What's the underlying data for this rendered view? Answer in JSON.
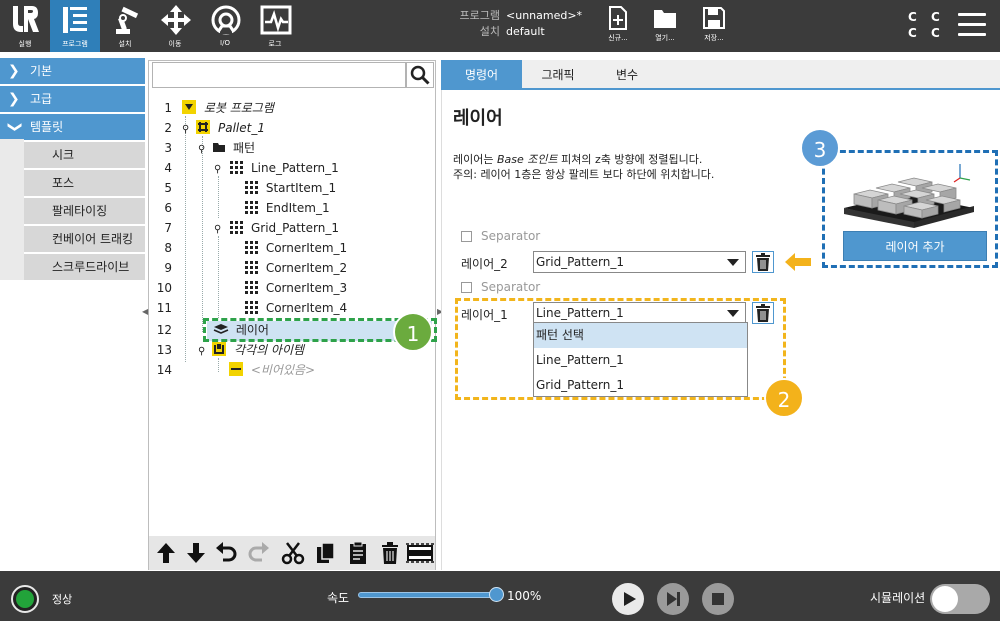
{
  "topbar": {
    "nav": [
      {
        "label": "실행",
        "icon": "ur-logo-icon"
      },
      {
        "label": "프로그램",
        "icon": "program-icon"
      },
      {
        "label": "설치",
        "icon": "robot-arm-icon"
      },
      {
        "label": "이동",
        "icon": "move-arrows-icon"
      },
      {
        "label": "I/O",
        "icon": "io-icon"
      },
      {
        "label": "로그",
        "icon": "log-icon"
      }
    ],
    "program_label": "프로그램",
    "program_value": "<unnamed>*",
    "install_label": "설치",
    "install_value": "default",
    "file_buttons": [
      {
        "label": "신규...",
        "icon": "new-file-icon"
      },
      {
        "label": "열기...",
        "icon": "open-folder-icon"
      },
      {
        "label": "저장...",
        "icon": "save-icon"
      }
    ],
    "cc_text": [
      "C C",
      "C C"
    ]
  },
  "sidebar": {
    "categories": [
      {
        "label": "기본",
        "expanded": false
      },
      {
        "label": "고급",
        "expanded": false
      },
      {
        "label": "템플릿",
        "expanded": true
      }
    ],
    "template_items": [
      "시크",
      "포스",
      "팔레타이징",
      "컨베이어 트래킹",
      "스크루드라이브"
    ]
  },
  "tree": {
    "rows": [
      {
        "num": "1",
        "label": "로봇 프로그램",
        "icon": "program-root-icon"
      },
      {
        "num": "2",
        "label": "Pallet_1",
        "icon": "pallet-icon"
      },
      {
        "num": "3",
        "label": "패턴",
        "icon": "folder-icon"
      },
      {
        "num": "4",
        "label": "Line_Pattern_1",
        "icon": "line-pattern-icon"
      },
      {
        "num": "5",
        "label": "StartItem_1",
        "icon": "grid-item-icon"
      },
      {
        "num": "6",
        "label": "EndItem_1",
        "icon": "grid-item-icon"
      },
      {
        "num": "7",
        "label": "Grid_Pattern_1",
        "icon": "grid-pattern-icon"
      },
      {
        "num": "8",
        "label": "CornerItem_1",
        "icon": "grid-item-icon"
      },
      {
        "num": "9",
        "label": "CornerItem_2",
        "icon": "grid-item-icon"
      },
      {
        "num": "10",
        "label": "CornerItem_3",
        "icon": "grid-item-icon"
      },
      {
        "num": "11",
        "label": "CornerItem_4",
        "icon": "grid-item-icon"
      },
      {
        "num": "12",
        "label": "레이어",
        "icon": "layer-icon"
      },
      {
        "num": "13",
        "label": "각각의 아이템",
        "icon": "each-item-icon"
      },
      {
        "num": "14",
        "label": "<비어있음>",
        "icon": "empty-icon"
      }
    ],
    "toolbar": [
      "move-up-icon",
      "move-down-icon",
      "undo-icon",
      "redo-icon",
      "cut-icon",
      "copy-icon",
      "paste-icon",
      "delete-icon",
      "suppress-icon"
    ]
  },
  "tabs": [
    "명령어",
    "그래픽",
    "변수"
  ],
  "panel": {
    "title": "레이어",
    "desc_line1_pre": "레이어는 ",
    "desc_line1_em": "Base 조인트",
    "desc_line1_post": " 피쳐의 z축 방향에 정렬됩니다.",
    "desc_line2": "주의: 레이어 1층은 항상 팔레트 보다 하단에 위치합니다.",
    "separator_label": "Separator",
    "layer2_label": "레이어_2",
    "layer2_value": "Grid_Pattern_1",
    "layer1_label": "레이어_1",
    "layer1_value": "Line_Pattern_1",
    "dropdown_options": [
      "패턴 선택",
      "Line_Pattern_1",
      "Grid_Pattern_1"
    ],
    "add_layer_label": "레이어 추가"
  },
  "annotations": [
    "1",
    "2",
    "3"
  ],
  "colors": {
    "accent": "#4f97cf",
    "annotation_green": "#6bab3e",
    "annotation_yellow": "#f3b21b",
    "annotation_blue": "#5b9bd5",
    "dash_green": "#2ea24a",
    "dash_yellow": "#f2b51c",
    "dash_blue": "#1f6fb5"
  },
  "bottombar": {
    "status": "정상",
    "speed_label": "속도",
    "speed_value": "100%",
    "speed_fraction": 1.0,
    "simulation_label": "시뮬레이션",
    "simulation_on": false
  }
}
